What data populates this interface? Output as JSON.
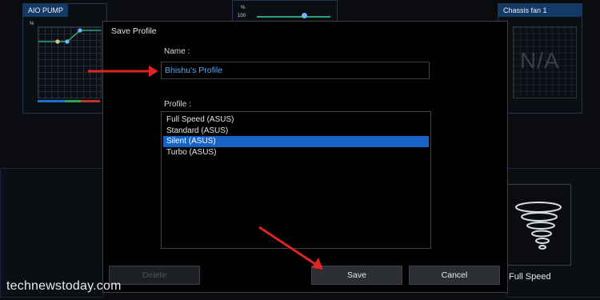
{
  "panels": {
    "aio_pump_title": "AIO PUMP",
    "chassis_fan_title": "Chassis fan 1",
    "na_text": "N/A",
    "percent_symbol": "%",
    "mid_top_value": "100",
    "fan_mode_label": "Full Speed"
  },
  "dialog": {
    "title": "Save Profile",
    "name_label": "Name :",
    "name_value": "Bhishu's Profile",
    "profile_label": "Profile :",
    "profiles": [
      {
        "label": "Full Speed (ASUS)",
        "selected": false
      },
      {
        "label": "Standard (ASUS)",
        "selected": false
      },
      {
        "label": "Silent (ASUS)",
        "selected": true
      },
      {
        "label": "Turbo (ASUS)",
        "selected": false
      }
    ],
    "delete_label": "Delete",
    "save_label": "Save",
    "cancel_label": "Cancel"
  },
  "watermark": "technewstoday.com",
  "colors": {
    "accent_blue": "#1663c7",
    "annotation_red": "#e02424",
    "title_bar": "#143a66"
  }
}
